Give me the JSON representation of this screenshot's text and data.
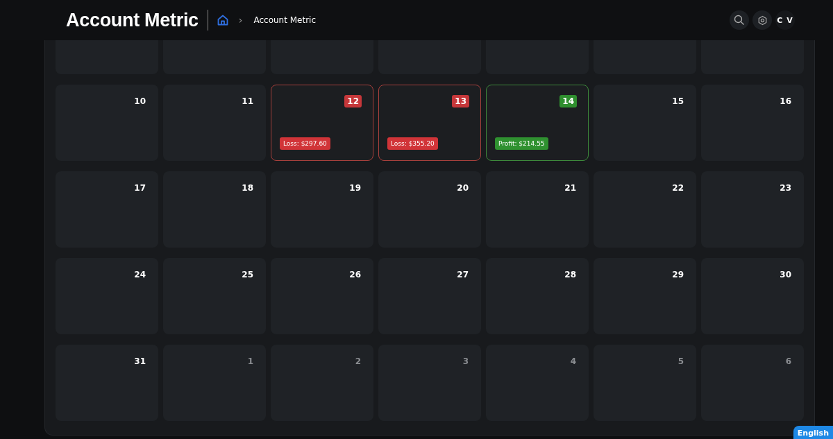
{
  "header": {
    "title": "Account Metric",
    "breadcrumb": {
      "separator": "›",
      "current": "Account Metric"
    },
    "avatar": "C V"
  },
  "weeks": [
    [
      {
        "day": "10",
        "muted": false
      },
      {
        "day": "11",
        "muted": false
      },
      {
        "day": "12",
        "muted": false,
        "result": {
          "kind": "loss",
          "label": "Loss: $297.60"
        }
      },
      {
        "day": "13",
        "muted": false,
        "result": {
          "kind": "loss",
          "label": "Loss: $355.20"
        }
      },
      {
        "day": "14",
        "muted": false,
        "result": {
          "kind": "profit",
          "label": "Profit: $214.55"
        }
      },
      {
        "day": "15",
        "muted": false
      },
      {
        "day": "16",
        "muted": false
      }
    ],
    [
      {
        "day": "17",
        "muted": false
      },
      {
        "day": "18",
        "muted": false
      },
      {
        "day": "19",
        "muted": false
      },
      {
        "day": "20",
        "muted": false
      },
      {
        "day": "21",
        "muted": false
      },
      {
        "day": "22",
        "muted": false
      },
      {
        "day": "23",
        "muted": false
      }
    ],
    [
      {
        "day": "24",
        "muted": false
      },
      {
        "day": "25",
        "muted": false
      },
      {
        "day": "26",
        "muted": false
      },
      {
        "day": "27",
        "muted": false
      },
      {
        "day": "28",
        "muted": false
      },
      {
        "day": "29",
        "muted": false
      },
      {
        "day": "30",
        "muted": false
      }
    ],
    [
      {
        "day": "31",
        "muted": false
      },
      {
        "day": "1",
        "muted": true
      },
      {
        "day": "2",
        "muted": true
      },
      {
        "day": "3",
        "muted": true
      },
      {
        "day": "4",
        "muted": true
      },
      {
        "day": "5",
        "muted": true
      },
      {
        "day": "6",
        "muted": true
      }
    ]
  ],
  "language_button": "English"
}
